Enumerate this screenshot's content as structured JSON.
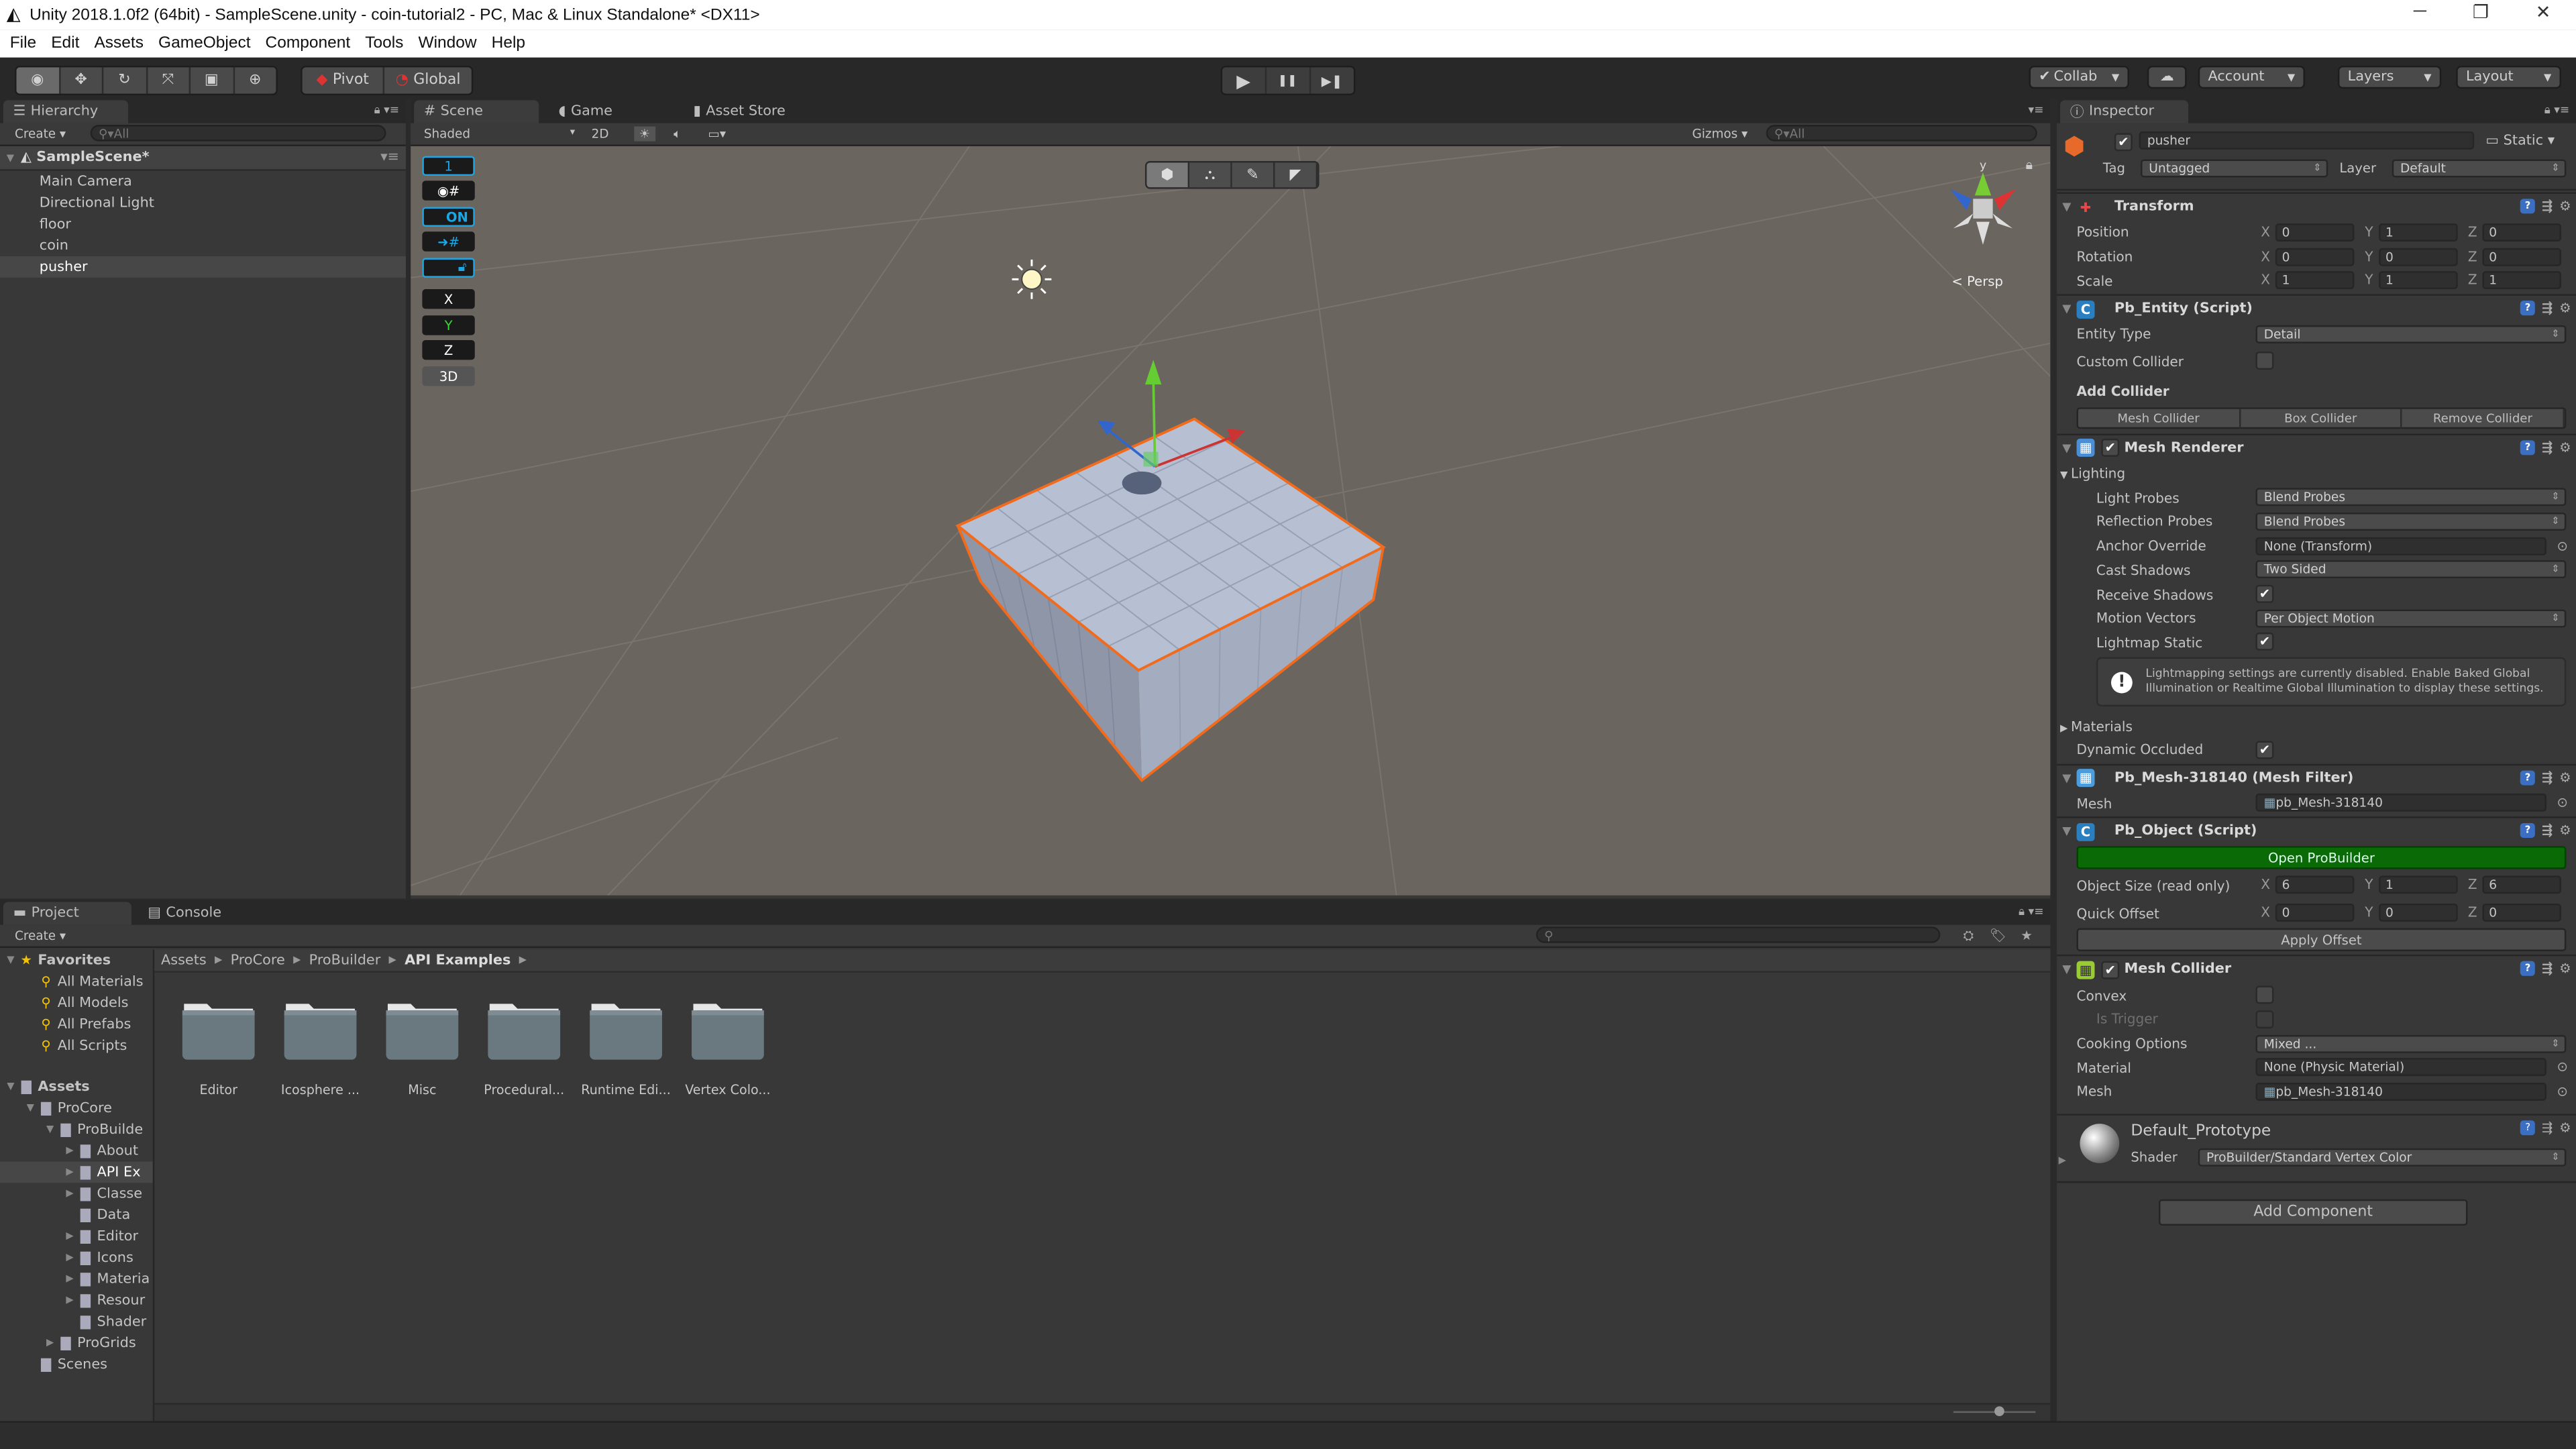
{
  "window": {
    "title": "Unity 2018.1.0f2 (64bit) - SampleScene.unity - coin-tutorial2 - PC, Mac & Linux Standalone* <DX11>",
    "minimize": "─",
    "restore": "❐",
    "close": "✕"
  },
  "menu": [
    "File",
    "Edit",
    "Assets",
    "GameObject",
    "Component",
    "Tools",
    "Window",
    "Help"
  ],
  "toolbar": {
    "tools": [
      "view-tool",
      "move-tool",
      "rotate-tool",
      "scale-tool",
      "rect-tool",
      "transform-tool"
    ],
    "active_tool": "view-tool",
    "pivot": "Pivot",
    "global": "Global",
    "play": "▶",
    "pause": "❚❚",
    "step": "▶❚",
    "collab": "Collab",
    "cloud": "☁",
    "account": "Account",
    "layers": "Layers",
    "layout": "Layout"
  },
  "hierarchy": {
    "tab": "Hierarchy",
    "create": "Create",
    "search_placeholder": "All",
    "scene": "SampleScene*",
    "items": [
      "Main Camera",
      "Directional Light",
      "floor",
      "coin",
      "pusher"
    ],
    "selected_index": 4
  },
  "scene": {
    "tabs": [
      "Scene",
      "Game",
      "Asset Store"
    ],
    "active_tab": "Scene",
    "shading": "Shaded",
    "mode_2d": "2D",
    "gizmos": "Gizmos",
    "search_placeholder": "All",
    "persp": "Persp",
    "progrids": {
      "grid_size": "1",
      "snap_on": "ON",
      "x": "X",
      "y": "Y",
      "z": "Z",
      "mode_3d": "3D"
    },
    "gizmo_axis_y": "y"
  },
  "inspector": {
    "tab": "Inspector",
    "object_name": "pusher",
    "active": true,
    "static_label": "Static",
    "tag_label": "Tag",
    "tag": "Untagged",
    "layer_label": "Layer",
    "layer": "Default",
    "components": [
      {
        "title": "Transform",
        "icon": "transform-icon",
        "rows": [
          {
            "type": "vec3",
            "label": "Position",
            "x": "0",
            "y": "1",
            "z": "0"
          },
          {
            "type": "vec3",
            "label": "Rotation",
            "x": "0",
            "y": "0",
            "z": "0"
          },
          {
            "type": "vec3",
            "label": "Scale",
            "x": "1",
            "y": "1",
            "z": "1"
          }
        ]
      },
      {
        "title": "Pb_Entity (Script)",
        "icon": "script-icon",
        "rows": [
          {
            "type": "dropdown",
            "label": "Entity Type",
            "value": "Detail"
          },
          {
            "type": "checkbox",
            "label": "Custom Collider",
            "checked": false
          },
          {
            "type": "bold",
            "label": "Add Collider"
          },
          {
            "type": "buttons",
            "buttons": [
              "Mesh Collider",
              "Box Collider",
              "Remove Collider"
            ]
          }
        ]
      },
      {
        "title": "Mesh Renderer",
        "icon": "mesh-renderer-icon",
        "enabled": true,
        "rows": [
          {
            "type": "foldout",
            "label": "Lighting",
            "open": true
          },
          {
            "type": "dropdown",
            "label": "Light Probes",
            "value": "Blend Probes",
            "indent": true
          },
          {
            "type": "dropdown",
            "label": "Reflection Probes",
            "value": "Blend Probes",
            "indent": true
          },
          {
            "type": "object",
            "label": "Anchor Override",
            "value": "None (Transform)",
            "indent": true
          },
          {
            "type": "dropdown",
            "label": "Cast Shadows",
            "value": "Two Sided",
            "indent": true
          },
          {
            "type": "checkbox",
            "label": "Receive Shadows",
            "checked": true,
            "indent": true
          },
          {
            "type": "dropdown",
            "label": "Motion Vectors",
            "value": "Per Object Motion",
            "indent": true
          },
          {
            "type": "checkbox",
            "label": "Lightmap Static",
            "checked": true,
            "indent": true
          },
          {
            "type": "help",
            "text": "Lightmapping settings are currently disabled. Enable Baked Global Illumination or Realtime Global Illumination to display these settings."
          },
          {
            "type": "foldout",
            "label": "Materials",
            "open": false
          },
          {
            "type": "checkbox",
            "label": "Dynamic Occluded",
            "checked": true
          }
        ]
      },
      {
        "title": "Pb_Mesh-318140 (Mesh Filter)",
        "icon": "mesh-filter-icon",
        "rows": [
          {
            "type": "object",
            "label": "Mesh",
            "value": "pb_Mesh-318140",
            "mesh": true
          }
        ]
      },
      {
        "title": "Pb_Object (Script)",
        "icon": "script-icon",
        "rows": [
          {
            "type": "green",
            "label": "Open ProBuilder"
          },
          {
            "type": "vec3",
            "label": "Object Size (read only)",
            "x": "6",
            "y": "1",
            "z": "6"
          },
          {
            "type": "vec3",
            "label": "Quick Offset",
            "x": "0",
            "y": "0",
            "z": "0"
          },
          {
            "type": "button",
            "label": "Apply Offset"
          }
        ]
      },
      {
        "title": "Mesh Collider",
        "icon": "mesh-collider-icon",
        "enabled": true,
        "rows": [
          {
            "type": "checkbox",
            "label": "Convex",
            "checked": false
          },
          {
            "type": "checkbox",
            "label": "Is Trigger",
            "checked": false,
            "indent": true,
            "disabled": true
          },
          {
            "type": "dropdown",
            "label": "Cooking Options",
            "value": "Mixed ..."
          },
          {
            "type": "object",
            "label": "Material",
            "value": "None (Physic Material)"
          },
          {
            "type": "object",
            "label": "Mesh",
            "value": "pb_Mesh-318140",
            "mesh": true
          }
        ]
      }
    ],
    "material": {
      "name": "Default_Prototype",
      "shader_label": "Shader",
      "shader": "ProBuilder/Standard Vertex Color"
    },
    "add_component": "Add Component"
  },
  "project": {
    "tabs": [
      "Project",
      "Console"
    ],
    "create": "Create",
    "tree": [
      {
        "label": "Favorites",
        "level": 0,
        "icon": "star",
        "arrow": "open",
        "bold": true
      },
      {
        "label": "All Materials",
        "level": 1,
        "icon": "search"
      },
      {
        "label": "All Models",
        "level": 1,
        "icon": "search"
      },
      {
        "label": "All Prefabs",
        "level": 1,
        "icon": "search"
      },
      {
        "label": "All Scripts",
        "level": 1,
        "icon": "search"
      },
      {
        "label": "",
        "level": 0,
        "icon": "none"
      },
      {
        "label": "Assets",
        "level": 0,
        "icon": "folder",
        "arrow": "open",
        "bold": true
      },
      {
        "label": "ProCore",
        "level": 1,
        "icon": "folder",
        "arrow": "open"
      },
      {
        "label": "ProBuilde",
        "level": 2,
        "icon": "folder",
        "arrow": "open"
      },
      {
        "label": "About",
        "level": 3,
        "icon": "folder",
        "arrow": "closed"
      },
      {
        "label": "API Ex",
        "level": 3,
        "icon": "folder",
        "arrow": "closed",
        "selected": true
      },
      {
        "label": "Classe",
        "level": 3,
        "icon": "folder",
        "arrow": "closed"
      },
      {
        "label": "Data",
        "level": 3,
        "icon": "folder"
      },
      {
        "label": "Editor",
        "level": 3,
        "icon": "folder",
        "arrow": "closed"
      },
      {
        "label": "Icons",
        "level": 3,
        "icon": "folder",
        "arrow": "closed"
      },
      {
        "label": "Materia",
        "level": 3,
        "icon": "folder",
        "arrow": "closed"
      },
      {
        "label": "Resour",
        "level": 3,
        "icon": "folder",
        "arrow": "closed"
      },
      {
        "label": "Shader",
        "level": 3,
        "icon": "folder"
      },
      {
        "label": "ProGrids",
        "level": 2,
        "icon": "folder",
        "arrow": "closed"
      },
      {
        "label": "Scenes",
        "level": 1,
        "icon": "folder"
      }
    ],
    "breadcrumb": [
      "Assets",
      "ProCore",
      "ProBuilder",
      "API Examples"
    ],
    "folders": [
      "Editor",
      "Icosphere ...",
      "Misc",
      "Procedural...",
      "Runtime Edi...",
      "Vertex Colo..."
    ]
  },
  "colors": {
    "accent_blue": "#19a7e8",
    "selection_orange": "#f26b1d",
    "probuilder_green": "#0a6a06",
    "panel": "#383838",
    "viewport": "#6b655f",
    "cube_top": "#b7c0d3"
  }
}
